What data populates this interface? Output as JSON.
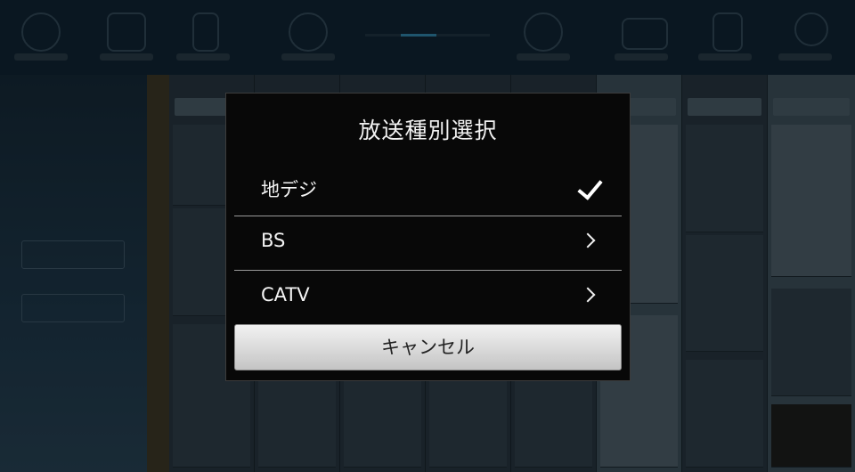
{
  "dialog": {
    "title": "放送種別選択",
    "options": [
      {
        "label": "地デジ",
        "selected": true,
        "indicator": "checkmark-icon"
      },
      {
        "label": "BS",
        "selected": false,
        "indicator": "chevron-right-icon"
      },
      {
        "label": "CATV",
        "selected": false,
        "indicator": "chevron-right-icon"
      }
    ],
    "cancel_label": "キャンセル"
  },
  "colors": {
    "dialog_background": "#080808",
    "separator": "#9a9a9a",
    "button_light": "#f2f2f2",
    "button_dark": "#c4c4c4"
  }
}
